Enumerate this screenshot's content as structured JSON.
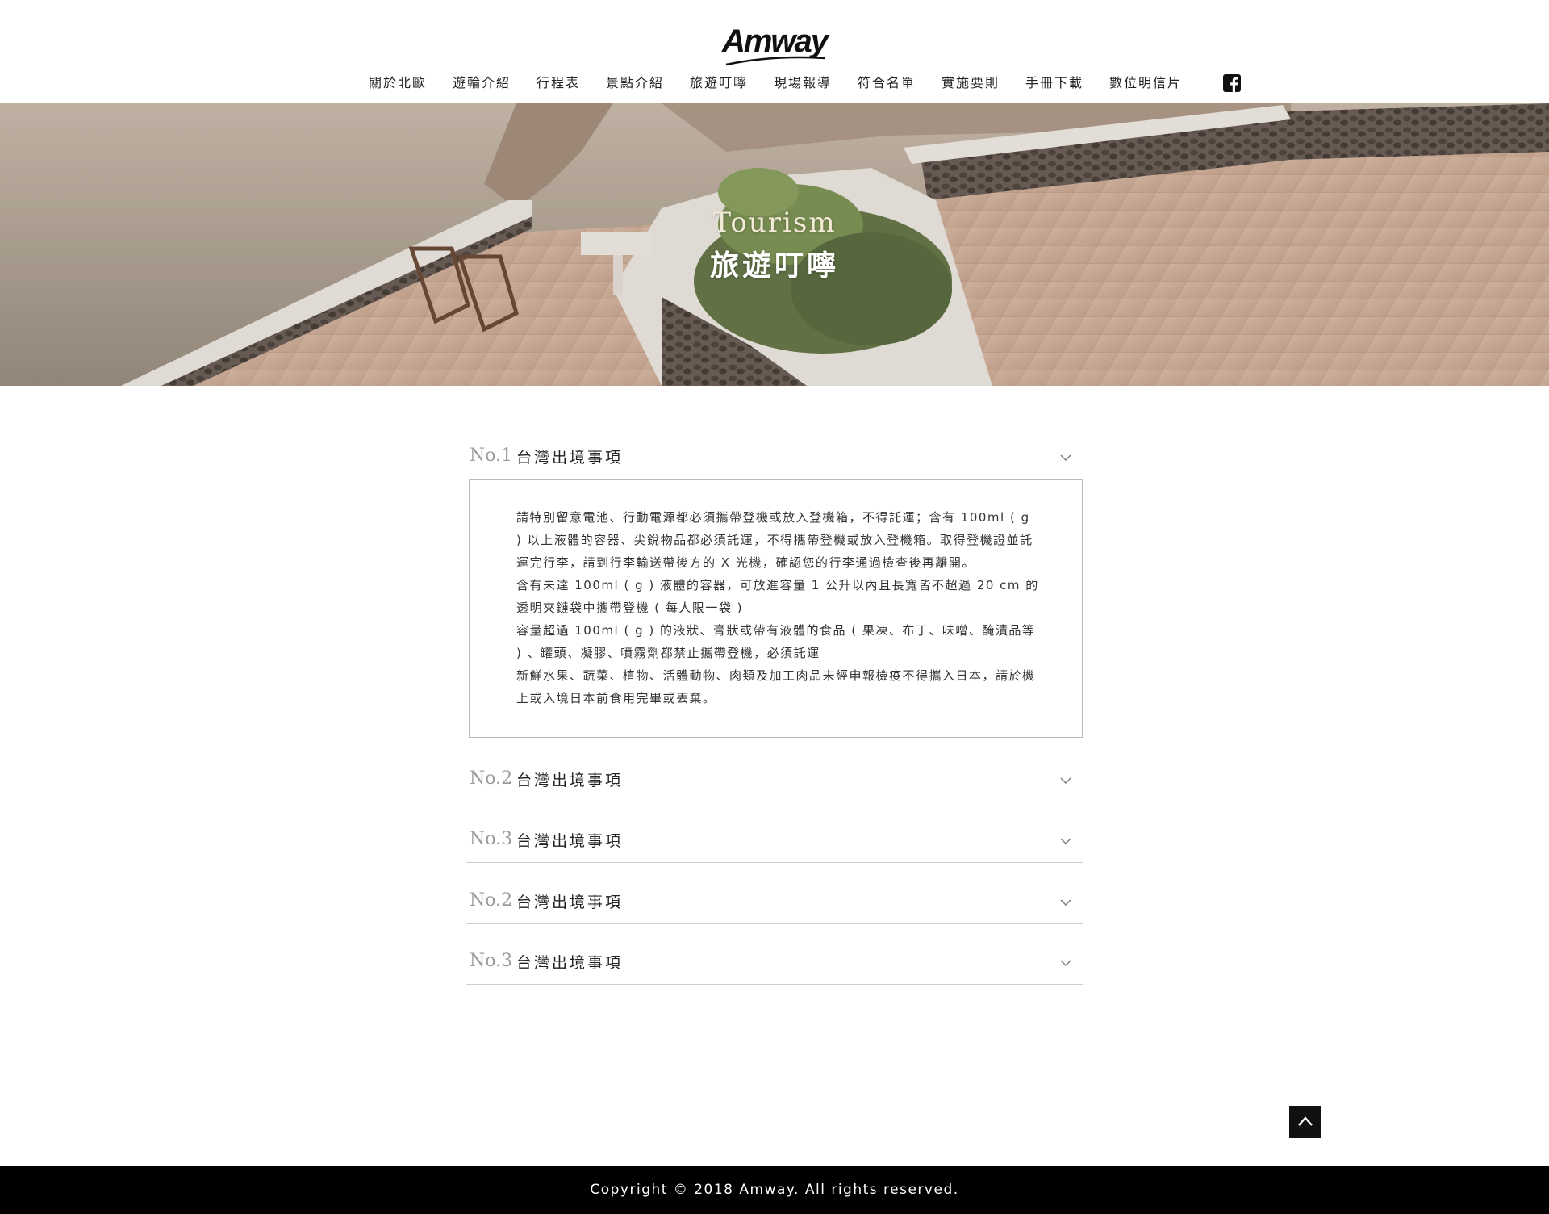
{
  "brand": {
    "logo_text": "Amway"
  },
  "nav": {
    "items": [
      {
        "label": "關於北歐"
      },
      {
        "label": "遊輪介紹"
      },
      {
        "label": "行程表"
      },
      {
        "label": "景點介紹"
      },
      {
        "label": "旅遊叮嚀"
      },
      {
        "label": "現場報導"
      },
      {
        "label": "符合名單"
      },
      {
        "label": "實施要則"
      },
      {
        "label": "手冊下載"
      },
      {
        "label": "數位明信片"
      }
    ],
    "facebook_icon": "facebook-icon"
  },
  "banner": {
    "title_en": "Tourism",
    "title_zh": "旅遊叮嚀"
  },
  "accordion": {
    "items": [
      {
        "no": "No.1",
        "title": "台灣出境事項",
        "expanded": true,
        "content": [
          "請特別留意電池、行動電源都必須攜帶登機或放入登機箱，不得託運；含有 100ml ( g ) 以上液體的容器、尖銳物品都必須託運，不得攜帶登機或放入登機箱。取得登機證並託運完行李，請到行李輸送帶後方的 X 光機，確認您的行李通過檢查後再離開。",
          "含有未達 100ml ( g ) 液體的容器，可放進容量 1 公升以內且長寬皆不超過 20 cm 的透明夾鏈袋中攜帶登機 ( 每人限一袋 )",
          "容量超過 100ml ( g ) 的液狀、膏狀或帶有液體的食品 ( 果凍、布丁、味噌、醃漬品等 ) 、罐頭、凝膠、噴霧劑都禁止攜帶登機，必須託運",
          "新鮮水果、蔬菜、植物、活體動物、肉類及加工肉品未經申報檢疫不得攜入日本，請於機上或入境日本前食用完畢或丟棄。"
        ]
      },
      {
        "no": "No.2",
        "title": "台灣出境事項",
        "expanded": false
      },
      {
        "no": "No.3",
        "title": "台灣出境事項",
        "expanded": false
      },
      {
        "no": "No.2",
        "title": "台灣出境事項",
        "expanded": false
      },
      {
        "no": "No.3",
        "title": "台灣出境事項",
        "expanded": false
      }
    ]
  },
  "back_to_top_icon": "chevron-up-icon",
  "footer": {
    "copyright": "Copyright © 2018  Amway. All rights reserved."
  }
}
